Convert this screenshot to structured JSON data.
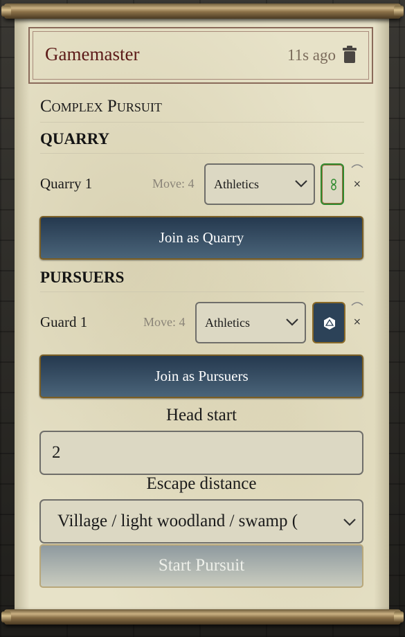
{
  "header": {
    "title": "Gamemaster",
    "time": "11s ago"
  },
  "section_title": "Complex Pursuit",
  "quarry": {
    "heading": "QUARRY",
    "row": {
      "name": "Quarry 1",
      "move": "Move: 4",
      "skill": "Athletics"
    },
    "join_label": "Join as Quarry"
  },
  "pursuers": {
    "heading": "PURSUERS",
    "row": {
      "name": "Guard 1",
      "move": "Move: 4",
      "skill": "Athletics"
    },
    "join_label": "Join as Pursuers"
  },
  "head_start": {
    "label": "Head start",
    "value": "2"
  },
  "escape_distance": {
    "label": "Escape distance",
    "value": "Village / light woodland / swamp ("
  },
  "start_label": "Start Pursuit",
  "remove_glyph": "×",
  "colors": {
    "accent_blue": "#2c4258",
    "title_red": "#5c1a18",
    "parchment": "#e7e2c8",
    "button_border": "#7a5e24"
  }
}
